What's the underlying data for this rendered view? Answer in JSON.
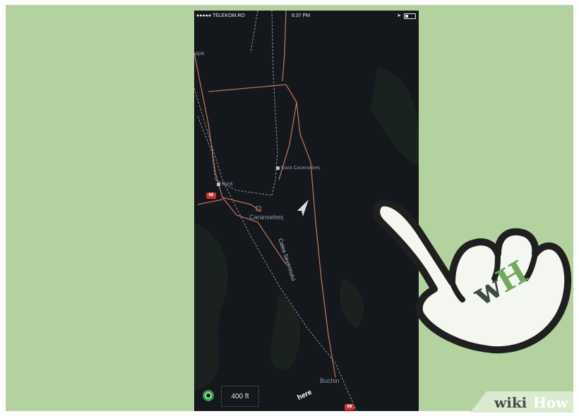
{
  "status_bar": {
    "carrier": "●●●●● TELEKOM.RO",
    "wifi_icon": "wifi-icon",
    "time": "6:37 PM",
    "location_icon": "location-arrow-icon",
    "battery_icon": "battery-icon"
  },
  "map": {
    "labels": {
      "left_edge": "apa",
      "town": "Caransebeș",
      "road": "Calea Severinului",
      "village": "Buchin"
    },
    "pois": {
      "station_1": "Gara Caransebeș",
      "station_2": "Gară"
    },
    "route_badges": [
      "68",
      "68"
    ],
    "current_location_icon": "navigation-arrow-icon"
  },
  "controls": {
    "locate_icon": "locate-me-icon",
    "scale": "400 ft",
    "brand": "here"
  },
  "overlay": {
    "logo_w": "w",
    "logo_h": "H",
    "watermark_wiki": "wiki",
    "watermark_how": "How"
  },
  "colors": {
    "background": "#b3d2a0",
    "map_background": "#14171b",
    "road": "#b8735a",
    "rail": "#8a929c",
    "route_badge": "#c8342c",
    "locate_button": "#2f9e44",
    "logo_green": "#6fa85e"
  }
}
